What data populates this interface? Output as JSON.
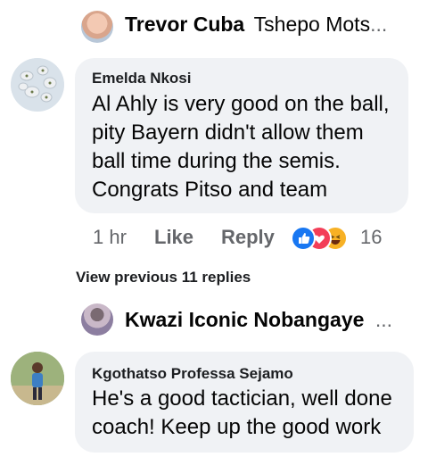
{
  "top_reply": {
    "name": "Trevor Cuba",
    "snippet": "Tshepo Mots",
    "ellipsis": "..."
  },
  "comment1": {
    "author": "Emelda Nkosi",
    "text_lines": [
      "Al Ahly is very good on the ball,",
      "pity Bayern didn't allow them",
      "ball time during the semis.",
      "Congrats Pitso and team"
    ],
    "time": "1 hr",
    "like_label": "Like",
    "reply_label": "Reply",
    "reactions": [
      "like-icon",
      "love-icon",
      "haha-icon"
    ],
    "reaction_count": "16"
  },
  "view_previous": "View previous 11 replies",
  "reply2": {
    "name": "Kwazi Iconic Nobangaye",
    "ellipsis": "..."
  },
  "comment2": {
    "author": "Kgothatso Professa Sejamo",
    "text_lines": [
      "He's a good tactician, well done",
      "coach! Keep up the good work"
    ]
  },
  "colors": {
    "bubble": "#f0f2f5",
    "meta_gray": "#65676b",
    "like_blue": "#1877f2",
    "love_red": "#f33e58",
    "haha_yellow": "#f7b125"
  }
}
